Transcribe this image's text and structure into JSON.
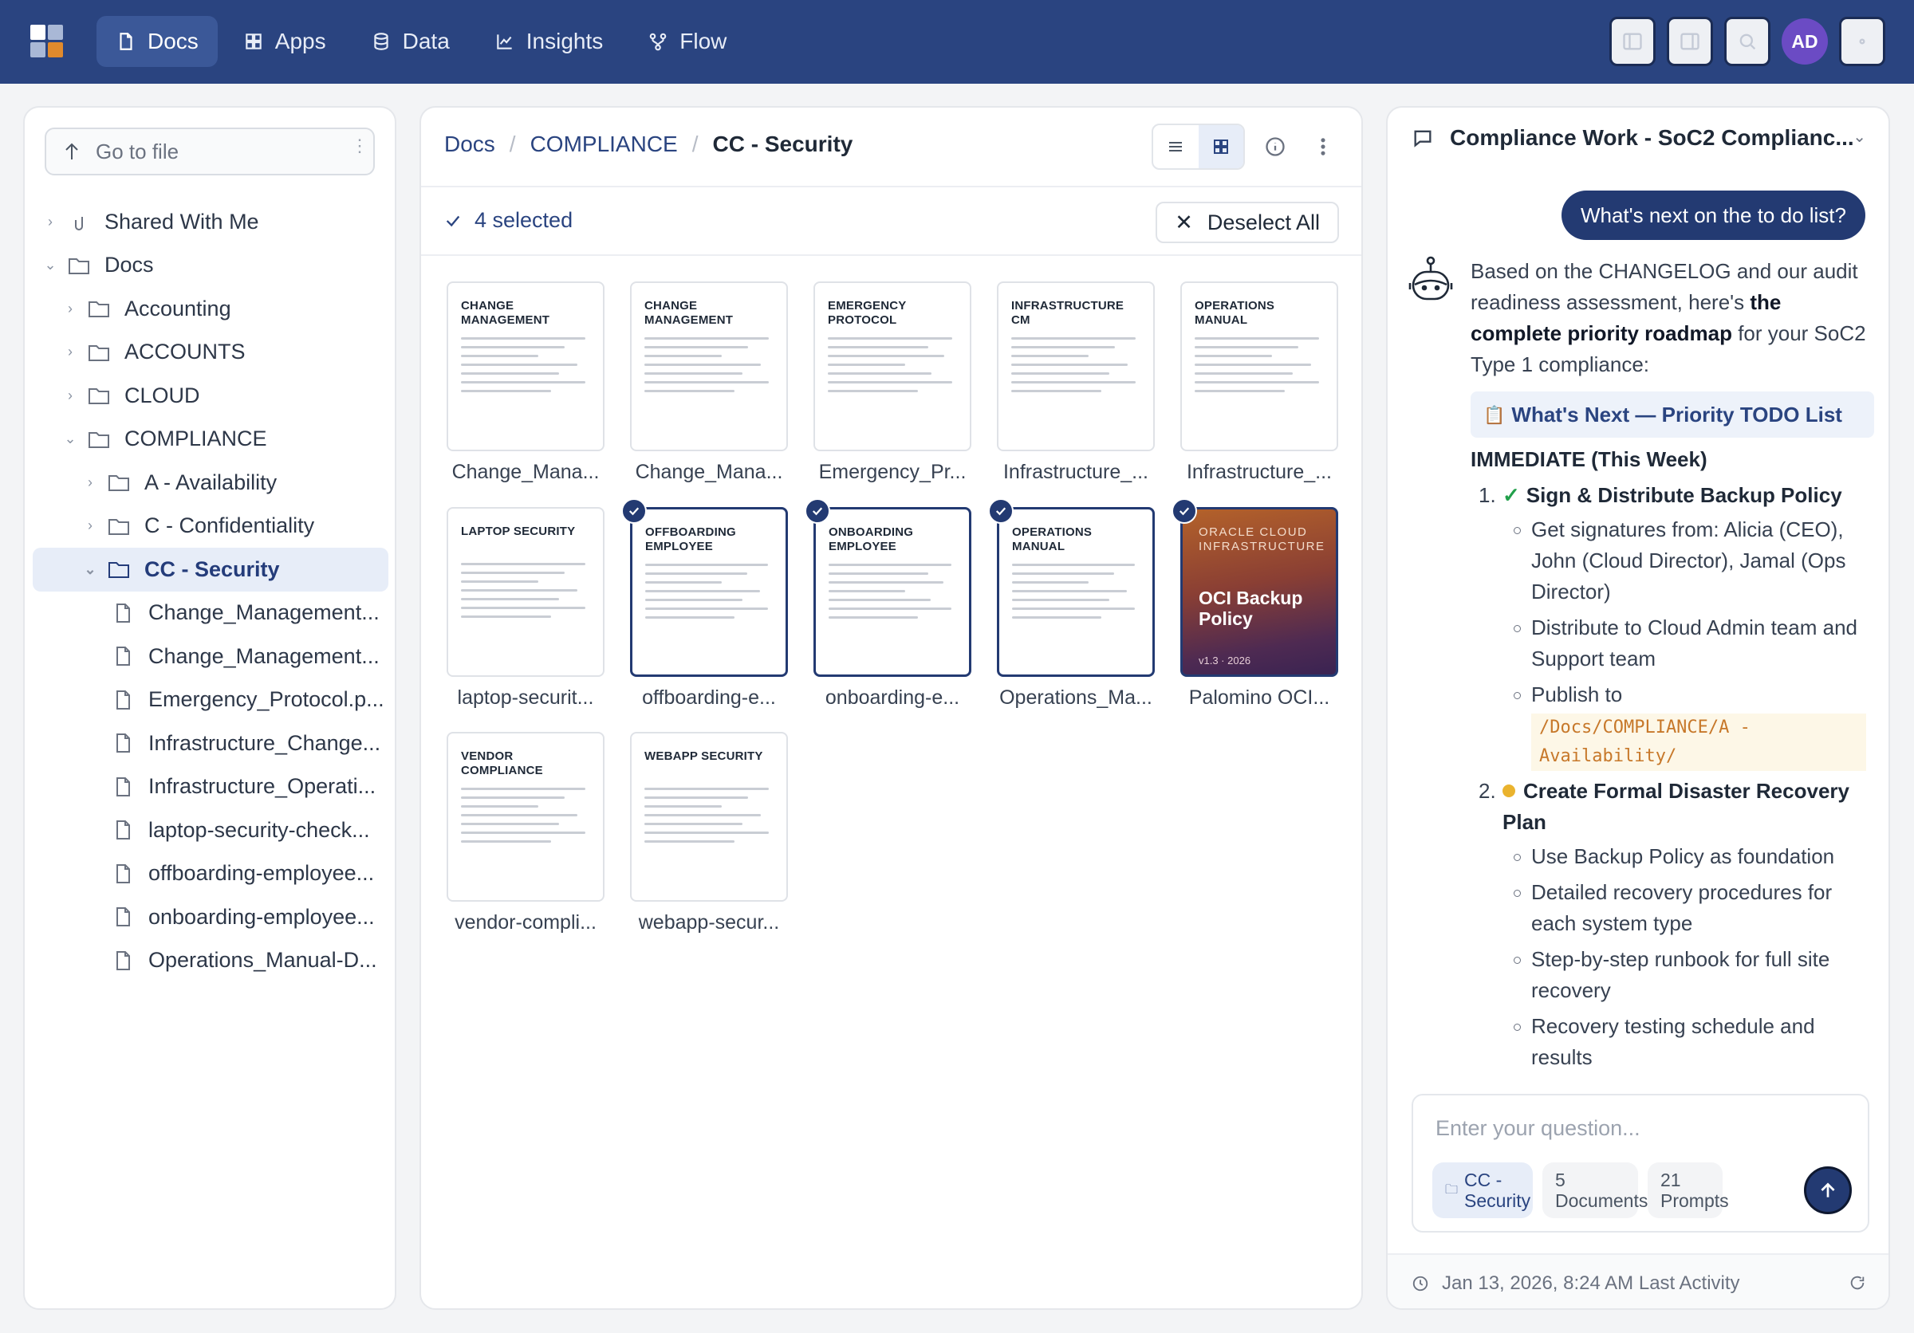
{
  "topnav": {
    "logo_colors": [
      "#ffffff",
      "#a9b8d6",
      "#a9b8d6",
      "#e08a2c"
    ],
    "items": [
      {
        "label": "Docs",
        "icon": "document-icon",
        "active": true
      },
      {
        "label": "Apps",
        "icon": "grid-icon",
        "active": false
      },
      {
        "label": "Data",
        "icon": "database-icon",
        "active": false
      },
      {
        "label": "Insights",
        "icon": "chart-line-icon",
        "active": false
      },
      {
        "label": "Flow",
        "icon": "flow-icon",
        "active": false
      }
    ],
    "avatar_initials": "AD"
  },
  "sidebar": {
    "goto_placeholder": "Go to file",
    "tree": [
      {
        "label": "Shared With Me",
        "type": "shared",
        "depth": 0,
        "expanded": false
      },
      {
        "label": "Docs",
        "type": "folder",
        "depth": 0,
        "expanded": true
      },
      {
        "label": "Accounting",
        "type": "folder",
        "depth": 1,
        "expanded": false
      },
      {
        "label": "ACCOUNTS",
        "type": "folder",
        "depth": 1,
        "expanded": false
      },
      {
        "label": "CLOUD",
        "type": "folder",
        "depth": 1,
        "expanded": false
      },
      {
        "label": "COMPLIANCE",
        "type": "folder",
        "depth": 1,
        "expanded": true
      },
      {
        "label": "A - Availability",
        "type": "folder",
        "depth": 2,
        "expanded": false
      },
      {
        "label": "C - Confidentiality",
        "type": "folder",
        "depth": 2,
        "expanded": false
      },
      {
        "label": "CC - Security",
        "type": "folder",
        "depth": 2,
        "expanded": true,
        "selected": true
      },
      {
        "label": "Change_Management...",
        "type": "file",
        "depth": 3
      },
      {
        "label": "Change_Management...",
        "type": "file",
        "depth": 3
      },
      {
        "label": "Emergency_Protocol.p...",
        "type": "file",
        "depth": 3
      },
      {
        "label": "Infrastructure_Change...",
        "type": "file",
        "depth": 3
      },
      {
        "label": "Infrastructure_Operati...",
        "type": "file",
        "depth": 3
      },
      {
        "label": "laptop-security-check...",
        "type": "file",
        "depth": 3
      },
      {
        "label": "offboarding-employee...",
        "type": "file",
        "depth": 3
      },
      {
        "label": "onboarding-employee...",
        "type": "file",
        "depth": 3
      },
      {
        "label": "Operations_Manual-D...",
        "type": "file",
        "depth": 3
      }
    ]
  },
  "center": {
    "breadcrumb": [
      "Docs",
      "COMPLIANCE",
      "CC - Security"
    ],
    "selected_label": "4 selected",
    "deselect_label": "Deselect All",
    "cards": [
      {
        "title": "CHANGE MANAGEMENT",
        "caption": "Change_Mana...",
        "selected": false
      },
      {
        "title": "CHANGE MANAGEMENT",
        "caption": "Change_Mana...",
        "selected": false
      },
      {
        "title": "EMERGENCY PROTOCOL",
        "caption": "Emergency_Pr...",
        "selected": false
      },
      {
        "title": "INFRASTRUCTURE CM",
        "caption": "Infrastructure_...",
        "selected": false
      },
      {
        "title": "OPERATIONS MANUAL",
        "caption": "Infrastructure_...",
        "selected": false
      },
      {
        "title": "LAPTOP SECURITY",
        "caption": "laptop-securit...",
        "selected": false
      },
      {
        "title": "OFFBOARDING EMPLOYEE",
        "caption": "offboarding-e...",
        "selected": true
      },
      {
        "title": "ONBOARDING EMPLOYEE",
        "caption": "onboarding-e...",
        "selected": true
      },
      {
        "title": "OPERATIONS MANUAL",
        "caption": "Operations_Ma...",
        "selected": true
      },
      {
        "title": "ORACLE CLOUD INFRASTRUCTURE",
        "caption": "Palomino OCI...",
        "selected": true,
        "cover": {
          "heading": "OCI Backup Policy",
          "version": "v1.3 · 2026"
        }
      },
      {
        "title": "VENDOR COMPLIANCE",
        "caption": "vendor-compli...",
        "selected": false
      },
      {
        "title": "WEBAPP SECURITY",
        "caption": "webapp-secur...",
        "selected": false
      }
    ]
  },
  "chat": {
    "title": "Compliance Work - SoC2 Complianc...",
    "user_message": "What's next on the to do list?",
    "reply_intro_1": "Based on the CHANGELOG and our audit readiness assessment, here's ",
    "reply_intro_bold": "the complete priority roadmap",
    "reply_intro_2": " for your SoC2 Type 1 compliance:",
    "todo_heading": "What's Next — Priority TODO List",
    "section_heading": "IMMEDIATE (This Week)",
    "items": [
      {
        "num": "1.",
        "status": "done",
        "heading": "Sign & Distribute Backup Policy",
        "bullets": [
          "Get signatures from: Alicia (CEO), John (Cloud Director), Jamal (Ops Director)",
          "Distribute to Cloud Admin team and Support team",
          "Publish to"
        ],
        "path": "/Docs/COMPLIANCE/A - Availability/"
      },
      {
        "num": "2.",
        "status": "pending",
        "heading": "Create Formal Disaster Recovery Plan",
        "bullets": [
          "Use Backup Policy as foundation",
          "Detailed recovery procedures for each system type",
          "Step-by-step runbook for full site recovery",
          "Recovery testing schedule and results"
        ]
      }
    ],
    "input_placeholder": "Enter your question...",
    "chips": [
      "CC - Security",
      "5 Documents",
      "21 Prompts"
    ],
    "last_activity": "Jan 13, 2026, 8:24 AM Last Activity"
  }
}
